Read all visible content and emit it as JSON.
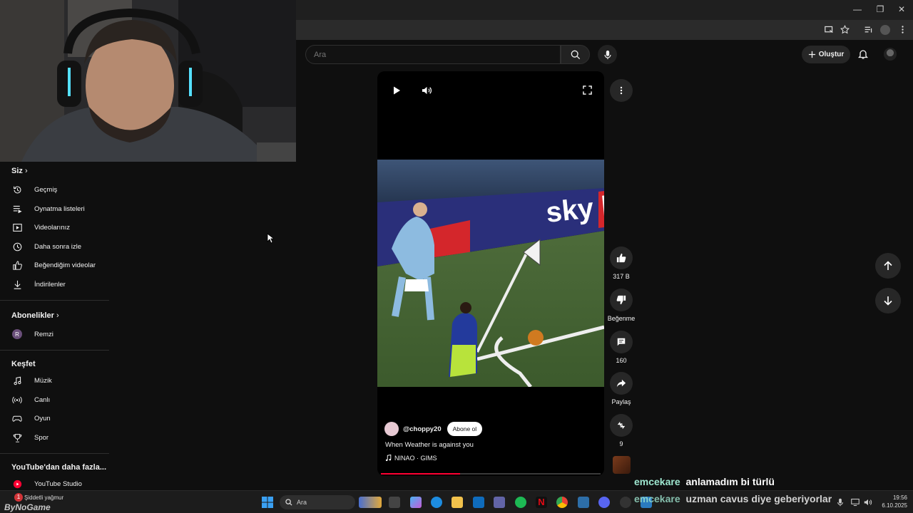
{
  "browser": {
    "window_controls": {
      "minimize": "—",
      "maximize": "❐",
      "close": "✕"
    }
  },
  "header": {
    "search_placeholder": "Ara",
    "create_label": "Oluştur"
  },
  "sidebar": {
    "you_section": "Siz",
    "you_items": [
      {
        "label": "Geçmiş",
        "icon": "history-icon"
      },
      {
        "label": "Oynatma listeleri",
        "icon": "playlist-icon"
      },
      {
        "label": "Videolarınız",
        "icon": "your-videos-icon"
      },
      {
        "label": "Daha sonra izle",
        "icon": "watch-later-icon"
      },
      {
        "label": "Beğendiğim videolar",
        "icon": "liked-icon"
      },
      {
        "label": "İndirilenler",
        "icon": "download-icon"
      }
    ],
    "subscriptions_section": "Abonelikler",
    "subscriptions": [
      {
        "label": "Remzi",
        "avatar_letter": "R"
      }
    ],
    "explore_section": "Keşfet",
    "explore_items": [
      {
        "label": "Müzik",
        "icon": "music-icon"
      },
      {
        "label": "Canlı",
        "icon": "live-icon"
      },
      {
        "label": "Oyun",
        "icon": "gaming-icon"
      },
      {
        "label": "Spor",
        "icon": "trophy-icon"
      }
    ],
    "more_section": "YouTube'dan daha fazla...",
    "more_items": [
      {
        "label": "YouTube Studio",
        "icon": "youtube-studio-icon"
      }
    ]
  },
  "short": {
    "channel": "@choppy20",
    "subscribe_label": "Abone ol",
    "title": "When Weather is against you",
    "music": "NINAO · GIMS",
    "progress": 0.36,
    "ad_text": "sky bet"
  },
  "actions": {
    "likes": "317 B",
    "dislike_label": "Beğenme",
    "comments": "160",
    "share_label": "Paylaş",
    "remix_count": "9"
  },
  "chat_overlay": [
    {
      "user": "emcekare",
      "message": "anlamadım bi türlü"
    },
    {
      "user": "emcekare",
      "message": "uzman cavus diye geberiyorlar"
    }
  ],
  "taskbar": {
    "weather": "Şiddetli yağmur",
    "weather_badge": "1",
    "search_placeholder": "Ara",
    "watermark": "ByNoGame",
    "time": "19:56",
    "date": "6.10.2025"
  },
  "colors": {
    "accent_red": "#ff0033",
    "chat_user": "#9ee6cf",
    "bg": "#0f0f0f"
  }
}
